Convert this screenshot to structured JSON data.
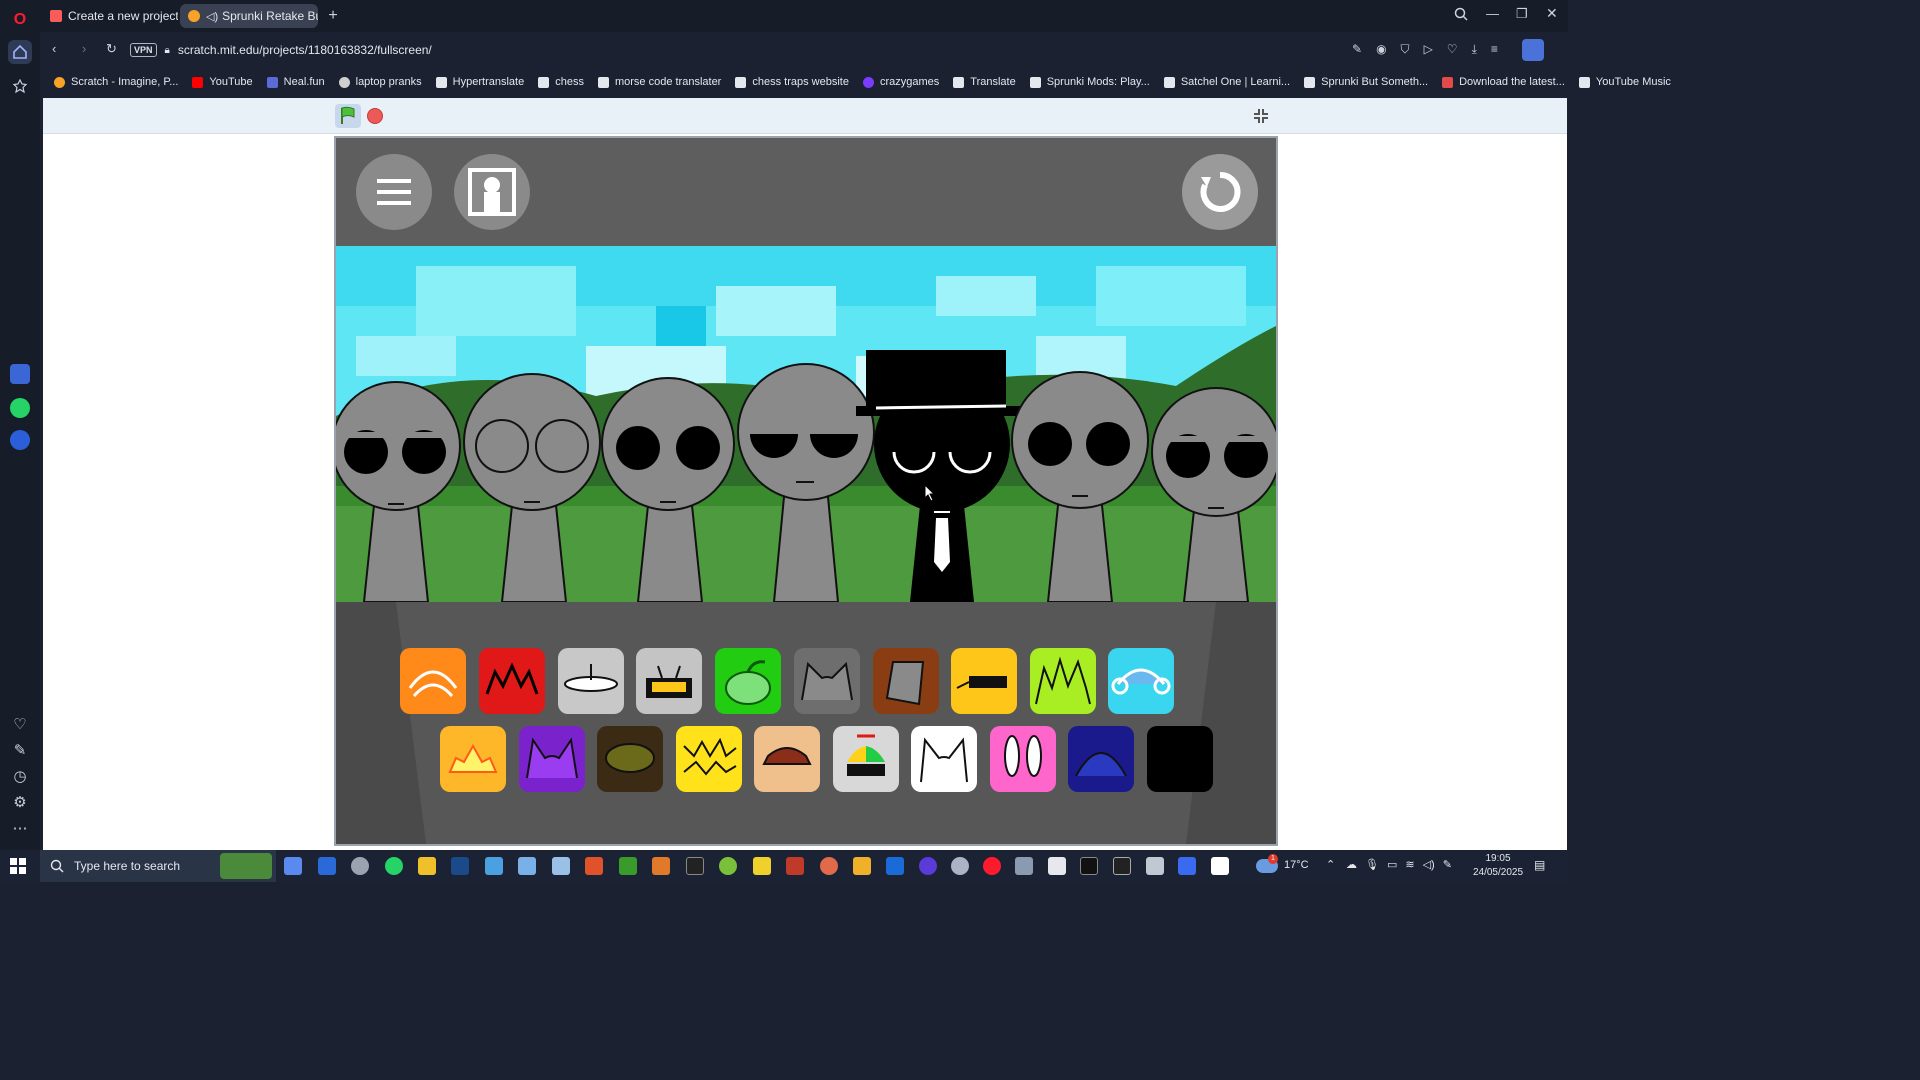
{
  "tabs": [
    {
      "label": "Create a new project - itch",
      "active": false
    },
    {
      "label": "Sprunki Retake But be",
      "active": true
    }
  ],
  "new_tab_symbol": "+",
  "url": "scratch.mit.edu/projects/1180163832/fullscreen/",
  "vpn_label": "VPN",
  "bookmarks": [
    {
      "label": "Scratch - Imagine, P...",
      "color": "#f7a328"
    },
    {
      "label": "YouTube",
      "color": "#ff0000"
    },
    {
      "label": "Neal.fun",
      "color": "#5b6bd6"
    },
    {
      "label": "laptop pranks",
      "color": "#cfcfcf"
    },
    {
      "label": "Hypertranslate",
      "color": "#cfcfcf"
    },
    {
      "label": "chess",
      "color": "#cfcfcf"
    },
    {
      "label": "morse code translater",
      "color": "#cfcfcf"
    },
    {
      "label": "chess traps website",
      "color": "#cfcfcf"
    },
    {
      "label": "crazygames",
      "color": "#7a3cff"
    },
    {
      "label": "Translate",
      "color": "#cfcfcf"
    },
    {
      "label": "Sprunki Mods: Play...",
      "color": "#cfcfcf"
    },
    {
      "label": "Satchel One | Learni...",
      "color": "#cfcfcf"
    },
    {
      "label": "Sprunki But Someth...",
      "color": "#cfcfcf"
    },
    {
      "label": "Download the latest...",
      "color": "#e34a4a"
    },
    {
      "label": "YouTube Music",
      "color": "#cfcfcf"
    }
  ],
  "stage_icons_row1": [
    {
      "name": "orange-crab-icon",
      "color": "#ff8a1a"
    },
    {
      "name": "red-spiky-icon",
      "color": "#e01818"
    },
    {
      "name": "gray-ufo-icon",
      "color": "#c8c8c8"
    },
    {
      "name": "gray-tv-icon",
      "color": "#c4c4c4"
    },
    {
      "name": "green-pumpkin-icon",
      "color": "#22cc11"
    },
    {
      "name": "gray-cat-ears-icon",
      "color": "#6e6e6e"
    },
    {
      "name": "brown-bucket-icon",
      "color": "#8a3d12"
    },
    {
      "name": "yellow-cap-icon",
      "color": "#ffc61a"
    },
    {
      "name": "lime-grass-icon",
      "color": "#a8ee22"
    },
    {
      "name": "cyan-headphones-icon",
      "color": "#3ad6f0"
    }
  ],
  "stage_icons_row2": [
    {
      "name": "sun-icon",
      "color": "#ffb72a"
    },
    {
      "name": "purple-horns-icon",
      "color": "#7a22cc"
    },
    {
      "name": "olive-bush-icon",
      "color": "#3b2a14"
    },
    {
      "name": "yellow-lightning-icon",
      "color": "#ffe21a"
    },
    {
      "name": "tan-hat-icon",
      "color": "#f0c08c"
    },
    {
      "name": "propeller-cap-icon",
      "color": "#d8d8d8"
    },
    {
      "name": "white-cat-icon",
      "color": "#ffffff"
    },
    {
      "name": "pink-bunny-icon",
      "color": "#ff66cc"
    },
    {
      "name": "navy-dome-icon",
      "color": "#1a1a8c"
    },
    {
      "name": "black-square-icon",
      "color": "#000000"
    }
  ],
  "taskbar": {
    "search_placeholder": "Type here to search",
    "temperature": "17°C",
    "time": "19:05",
    "date": "24/05/2025",
    "notification_count": "1"
  }
}
